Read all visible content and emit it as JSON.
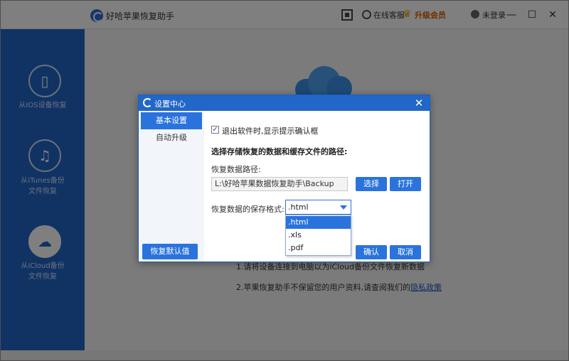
{
  "app": {
    "title": "好哈苹果恢复助手",
    "support_label": "在线客服",
    "vip_label": "升级会员",
    "login_label": "未登录",
    "minimize": "—",
    "maximize": "☐",
    "close": "✕",
    "accent": "#2266c8"
  },
  "sidebar": {
    "items": [
      {
        "line1": "从IOS设备恢复",
        "line2": "",
        "icon": "phone-icon"
      },
      {
        "line1": "从iTunes备份",
        "line2": "文件恢复",
        "icon": "music-folder-icon"
      },
      {
        "line1": "从iCloud备份",
        "line2": "文件恢复",
        "icon": "cloud-sync-icon",
        "active": true
      }
    ]
  },
  "main": {
    "tip1": "1.请将设备连接到电脑以为iCloud备份文件恢复新数据",
    "tip2_prefix": "2.苹果恢复助手不保留您的用户资料,请查阅我们的",
    "privacy_link": "隐私政策"
  },
  "dialog": {
    "title": "设置中心",
    "close": "✕",
    "nav": [
      {
        "label": "基本设置",
        "active": true
      },
      {
        "label": "自动升级",
        "active": false
      }
    ],
    "reset_label": "恢复默认值",
    "exit_confirm_checked": true,
    "exit_confirm_label": "退出软件时,显示提示确认框",
    "section_title": "选择存储恢复的数据和缓存文件的路径:",
    "path_label": "恢复数据路径:",
    "path_value": "L:\\好哈苹果数据恢复助手\\Backup",
    "browse_label": "选择",
    "open_label": "打开",
    "format_label": "恢复数据的保存格式:",
    "format_selected": ".html",
    "format_options": [
      ".html",
      ".xls",
      ".pdf"
    ],
    "ok_label": "确认",
    "cancel_label": "取消"
  }
}
